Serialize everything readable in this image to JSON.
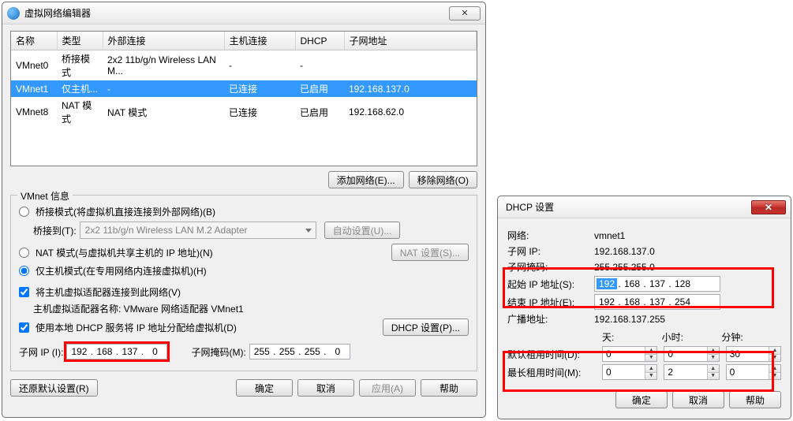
{
  "editor": {
    "title": "虚拟网络编辑器",
    "close_glyph": "✕",
    "table": {
      "headers": [
        "名称",
        "类型",
        "外部连接",
        "主机连接",
        "DHCP",
        "子网地址"
      ],
      "rows": [
        {
          "cells": [
            "VMnet0",
            "桥接模式",
            "2x2 11b/g/n Wireless LAN M...",
            "-",
            "-",
            ""
          ],
          "selected": false
        },
        {
          "cells": [
            "VMnet1",
            "仅主机...",
            "-",
            "已连接",
            "已启用",
            "192.168.137.0"
          ],
          "selected": true
        },
        {
          "cells": [
            "VMnet8",
            "NAT 模式",
            "NAT 模式",
            "已连接",
            "已启用",
            "192.168.62.0"
          ],
          "selected": false
        }
      ]
    },
    "add_net_label": "添加网络(E)...",
    "remove_net_label": "移除网络(O)",
    "group_legend": "VMnet 信息",
    "radio_bridge": "桥接模式(将虚拟机直接连接到外部网络)(B)",
    "bridge_to_label": "桥接到(T):",
    "bridge_combo": "2x2 11b/g/n Wireless LAN M.2 Adapter",
    "auto_config_btn": "自动设置(U)...",
    "radio_nat": "NAT 模式(与虚拟机共享主机的 IP 地址)(N)",
    "nat_settings_btn": "NAT 设置(S)...",
    "radio_host": "仅主机模式(在专用网络内连接虚拟机)(H)",
    "chk_host_adapter": "将主机虚拟适配器连接到此网络(V)",
    "host_adapter_name": "主机虚拟适配器名称: VMware 网络适配器 VMnet1",
    "chk_dhcp": "使用本地 DHCP 服务将 IP 地址分配给虚拟机(D)",
    "dhcp_settings_btn": "DHCP 设置(P)...",
    "subnet_ip_label": "子网 IP (I):",
    "subnet_ip": [
      "192",
      "168",
      "137",
      "0"
    ],
    "subnet_mask_label": "子网掩码(M):",
    "subnet_mask": [
      "255",
      "255",
      "255",
      "0"
    ],
    "restore_btn": "还原默认设置(R)",
    "ok_btn": "确定",
    "cancel_btn": "取消",
    "apply_btn": "应用(A)",
    "help_btn": "帮助"
  },
  "dhcp": {
    "title": "DHCP 设置",
    "close_glyph": "✕",
    "network_label": "网络:",
    "network_value": "vmnet1",
    "subnet_ip_label": "子网 IP:",
    "subnet_ip_value": "192.168.137.0",
    "subnet_mask_label": "子网掩码:",
    "subnet_mask_value": "255.255.255.0",
    "start_ip_label": "起始 IP 地址(S):",
    "start_ip": [
      "192",
      "168",
      "137",
      "128"
    ],
    "end_ip_label": "结束 IP 地址(E):",
    "end_ip": [
      "192",
      "168",
      "137",
      "254"
    ],
    "broadcast_label": "广播地址:",
    "broadcast_value": "192.168.137.255",
    "col_day": "天:",
    "col_hour": "小时:",
    "col_min": "分钟:",
    "default_lease_label": "默认租用时间(D):",
    "default_lease": {
      "d": "0",
      "h": "0",
      "m": "30"
    },
    "max_lease_label": "最长租用时间(M):",
    "max_lease": {
      "d": "0",
      "h": "2",
      "m": "0"
    },
    "ok_btn": "确定",
    "cancel_btn": "取消",
    "help_btn": "帮助"
  },
  "chart_data": null
}
